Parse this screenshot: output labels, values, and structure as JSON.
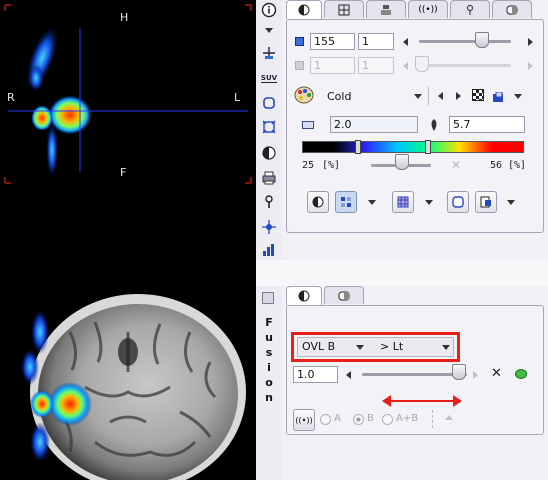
{
  "viewer": {
    "top": {
      "label_top": "H",
      "label_left": "R",
      "label_right": "L",
      "label_bottom": "F"
    }
  },
  "toolbar": {
    "icons": [
      "info-icon",
      "dropdown-icon",
      "crosshair-icon",
      "suv-icon",
      "roi-icon",
      "zoom-fit-icon",
      "contrast-icon",
      "print-icon",
      "probe-icon",
      "cursor-link-icon",
      "histogram-icon"
    ],
    "suv_label": "SUV"
  },
  "fusion": {
    "letters": [
      "F",
      "u",
      "s",
      "i",
      "o",
      "n"
    ]
  },
  "top_panel": {
    "tabs": [
      "contrast-tab",
      "layout-tab",
      "sync-tab",
      "broadcast-tab",
      "probe-tab",
      "settings-tab"
    ],
    "slice_value": "155",
    "frame_value": "1",
    "slice2_value": "1",
    "frame2_value": "1",
    "colortable": "Cold",
    "min_value": "2.0",
    "max_value": "5.7",
    "percent_left": "25",
    "percent_unit": "[%]",
    "percent_right": "56",
    "colorbar_colors": [
      "#000000",
      "#000000",
      "#2a2aff",
      "#00c8ff",
      "#00ff80",
      "#ffe000",
      "#ff0000",
      "#ff0000"
    ]
  },
  "bottom_panel": {
    "tabs": [
      "fusion-contrast-tab",
      "fusion-settings-tab"
    ],
    "overlay_mode": "OVL B",
    "direction": "> Lt",
    "fusion_value": "1.0",
    "radio_a": "A",
    "radio_b": "B",
    "radio_ab": "A+B",
    "highlight_color": "#e8201a",
    "arrow_color": "#e8201a"
  }
}
